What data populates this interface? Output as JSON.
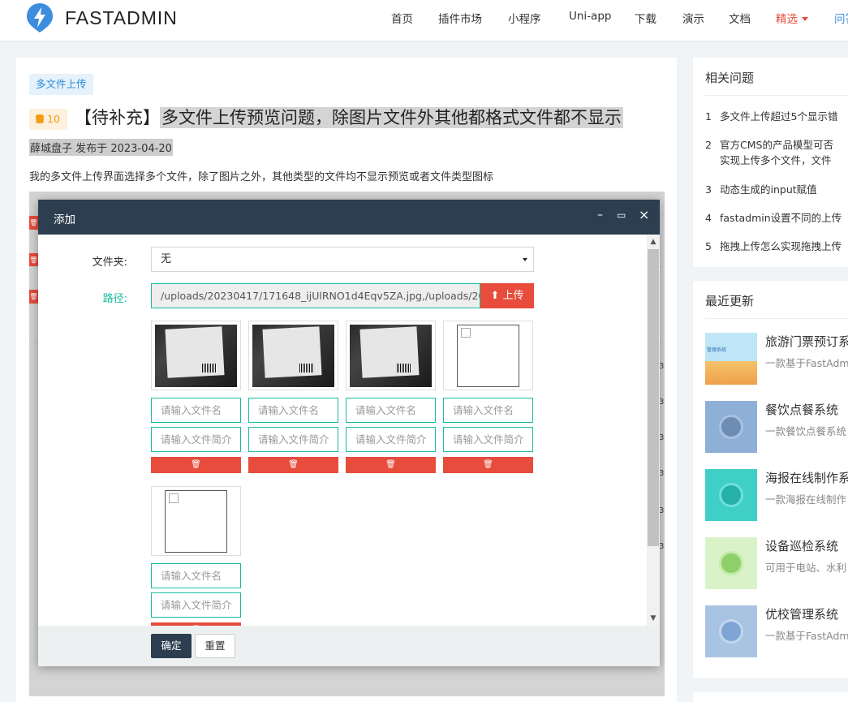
{
  "brand": "FASTADMIN",
  "nav": [
    "首页",
    "插件市场",
    "小程序",
    "Uni-app",
    "下载",
    "演示",
    "文档",
    "精选",
    "问答"
  ],
  "colors": {
    "accent": "#e74c3c",
    "brand_blue": "#3c8dde",
    "teal": "#18bc9c",
    "modal_header": "#2c3e50"
  },
  "post": {
    "tag": "多文件上传",
    "coin": "10",
    "title_prefix": "【待补充】",
    "title_main": "多文件上传预览问题，除图片文件外其他都格式文件都不显示",
    "author": "薛城盘子",
    "published_label": "发布于",
    "date": "2023-04-20",
    "description": "我的多文件上传界面选择多个文件，除了图片之外，其他类型的文件均不显示预览或者文件类型图标"
  },
  "modal": {
    "title": "添加",
    "ctrl_min": "–",
    "ctrl_max": "▭",
    "ctrl_close": "×",
    "folder_label": "文件夹:",
    "folder_value": "无",
    "path_label": "路径:",
    "path_value": "/uploads/20230417/171648_ijUlRNO1d4Eqv5ZA.jpg,/uploads/20230417",
    "upload_label": "上传",
    "name_placeholder": "请输入文件名",
    "intro_placeholder": "请输入文件简介",
    "ok_label": "确定",
    "reset_label": "重置"
  },
  "background_digits": [
    "3",
    "3",
    "3",
    "3",
    "3",
    "3"
  ],
  "sidebar": {
    "related_title": "相关问题",
    "related": [
      {
        "n": "1",
        "text": "多文件上传超过5个显示错"
      },
      {
        "n": "2",
        "text": "官方CMS的产品模型可否",
        "text2": "实现上传多个文件，文件"
      },
      {
        "n": "3",
        "text": "动态生成的input赋值"
      },
      {
        "n": "4",
        "text": "fastadmin设置不同的上传"
      },
      {
        "n": "5",
        "text": "拖拽上传怎么实现拖拽上传"
      }
    ],
    "recent_title": "最近更新",
    "recent": [
      {
        "title": "旅游门票预订系",
        "desc": "一款基于FastAdm",
        "thumb_label": "管理系统"
      },
      {
        "title": "餐饮点餐系统",
        "desc": "一款餐饮点餐系统"
      },
      {
        "title": "海报在线制作系",
        "desc": "一款海报在线制作"
      },
      {
        "title": "设备巡检系统",
        "desc": "可用于电站、水利"
      },
      {
        "title": "优校管理系统",
        "desc": "一款基于FastAdm"
      }
    ]
  }
}
